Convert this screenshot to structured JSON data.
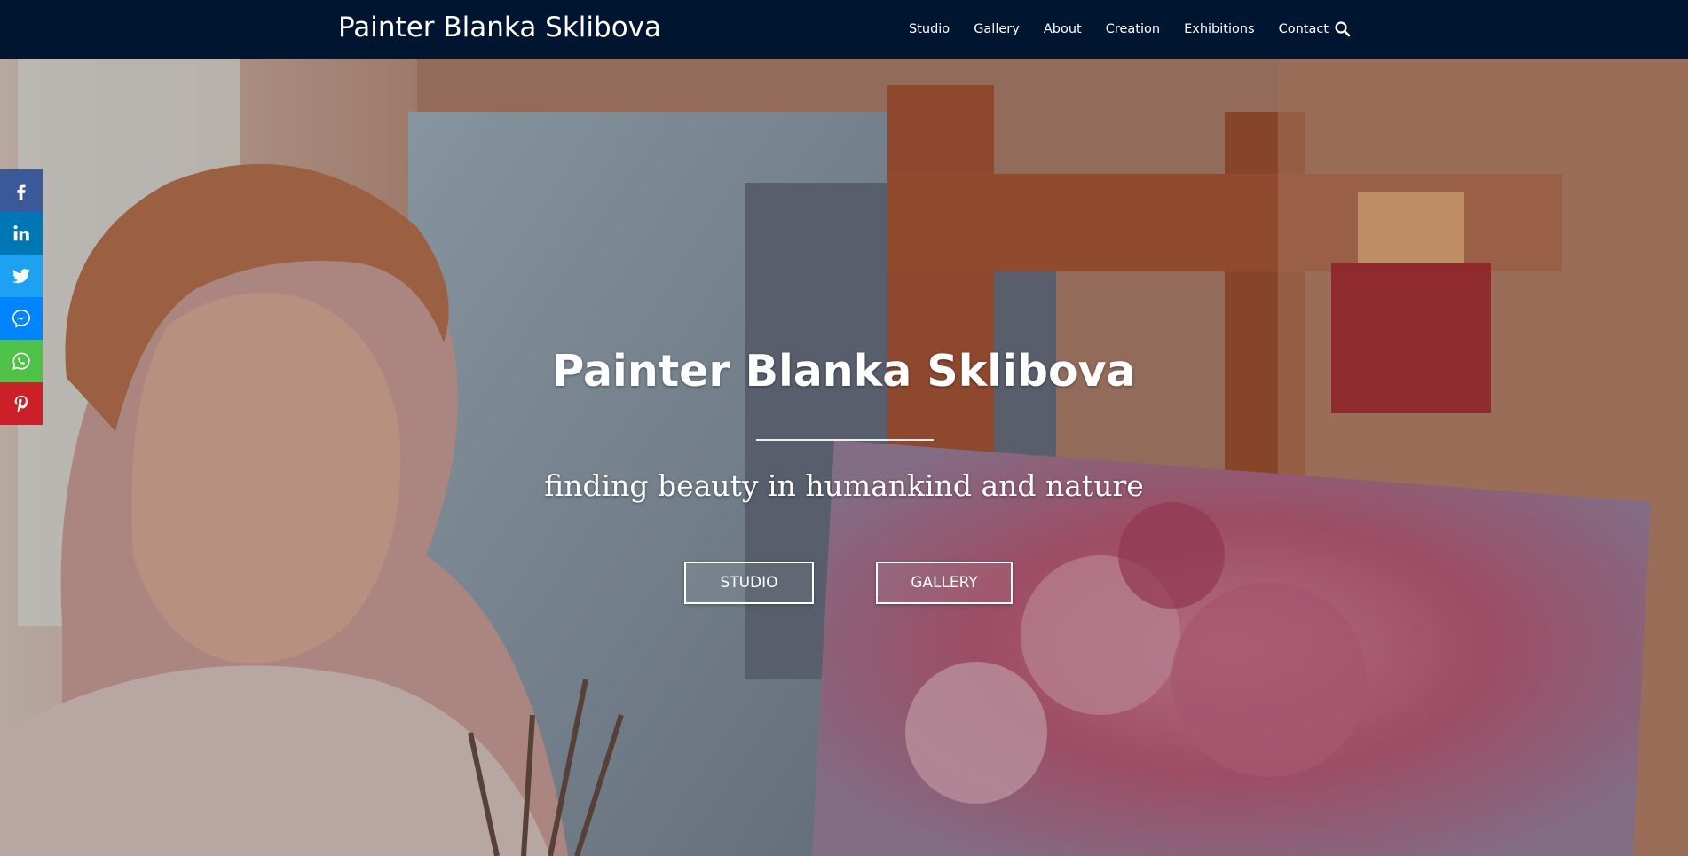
{
  "header": {
    "site_title": "Painter Blanka Sklibova",
    "nav": [
      "Studio",
      "Gallery",
      "About",
      "Creation",
      "Exhibitions",
      "Contact"
    ],
    "search_icon": "search-icon"
  },
  "hero": {
    "title": "Painter Blanka Sklibova",
    "tagline": "finding beauty in humankind and nature",
    "buttons": {
      "studio": "STUDIO",
      "gallery": "GALLERY"
    }
  },
  "share": {
    "icons": [
      "facebook-icon",
      "linkedin-icon",
      "twitter-icon",
      "messenger-icon",
      "whatsapp-icon",
      "pinterest-icon"
    ],
    "colors": {
      "facebook": "#3b5998",
      "linkedin": "#0077b5",
      "twitter": "#1da1f2",
      "messenger": "#0084ff",
      "whatsapp": "#4dc247",
      "pinterest": "#cb2027"
    }
  },
  "colors": {
    "header_bg": "#001530",
    "text": "#ffffff"
  }
}
